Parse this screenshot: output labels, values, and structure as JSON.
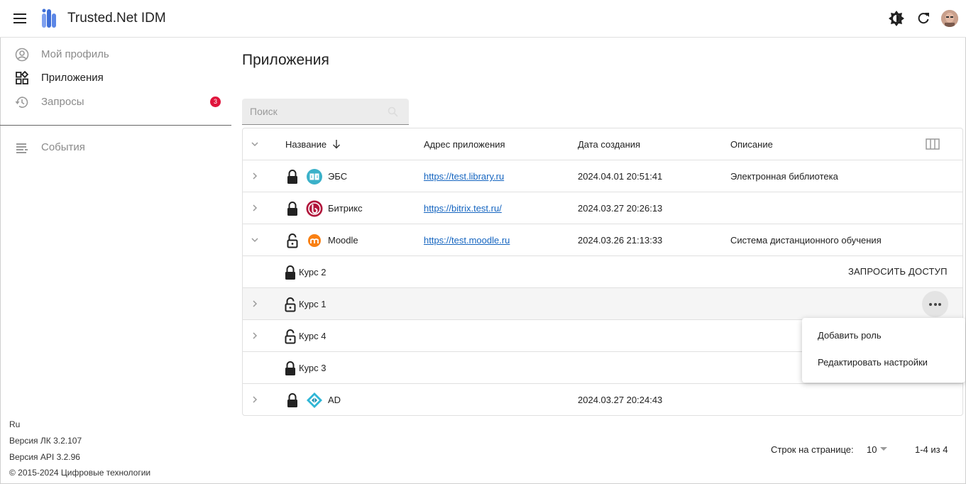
{
  "header": {
    "app_title": "Trusted.Net IDM"
  },
  "sidebar": {
    "items": [
      {
        "label": "Мой профиль",
        "icon": "account-circle-icon"
      },
      {
        "label": "Приложения",
        "icon": "apps-grid-icon"
      },
      {
        "label": "Запросы",
        "icon": "history-icon",
        "badge": "3"
      },
      {
        "label": "События",
        "icon": "list-icon"
      }
    ],
    "footer": {
      "lang": "Ru",
      "version_lk": "Версия ЛК 3.2.107",
      "version_api": "Версия API 3.2.96",
      "copyright": "© 2015-2024 Цифровые технологии"
    }
  },
  "main": {
    "title": "Приложения",
    "search_placeholder": "Поиск",
    "columns": {
      "name": "Название",
      "address": "Адрес приложения",
      "created": "Дата создания",
      "description": "Описание"
    },
    "rows": [
      {
        "name": "ЭБС",
        "address": "https://test.library.ru",
        "created": "2024.04.01 20:51:41",
        "description": "Электронная библиотека",
        "lock": "locked",
        "icon": "library-book-icon"
      },
      {
        "name": "Битрикс",
        "address": "https://bitrix.test.ru/",
        "created": "2024.03.27 20:26:13",
        "description": "",
        "lock": "locked",
        "icon": "bitrix-logo-icon"
      },
      {
        "name": "Moodle",
        "address": "https://test.moodle.ru",
        "created": "2024.03.26 21:13:33",
        "description": "Система дистанционного обучения",
        "lock": "unlocked",
        "icon": "moodle-logo-icon"
      },
      {
        "name": "Курс 2",
        "lock": "locked",
        "action": "ЗАПРОСИТЬ ДОСТУП"
      },
      {
        "name": "Курс 1",
        "lock": "unlocked"
      },
      {
        "name": "Курс 4",
        "lock": "unlocked"
      },
      {
        "name": "Курс 3",
        "lock": "locked"
      },
      {
        "name": "AD",
        "address": "",
        "created": "2024.03.27 20:24:43",
        "description": "",
        "lock": "locked",
        "icon": "ad-logo-icon"
      }
    ],
    "context_menu": [
      "Добавить роль",
      "Редактировать настройки"
    ],
    "pagination": {
      "rows_per_page_label": "Строк на странице:",
      "rows_per_page": "10",
      "range": "1-4 из 4"
    }
  },
  "colors": {
    "link": "#1565c0",
    "badge": "#e0143c",
    "logo_blue": "#3f6fd8",
    "bitrix_red": "#b1153b",
    "moodle_orange": "#f98012",
    "ebs_teal": "#3bb1c9"
  }
}
